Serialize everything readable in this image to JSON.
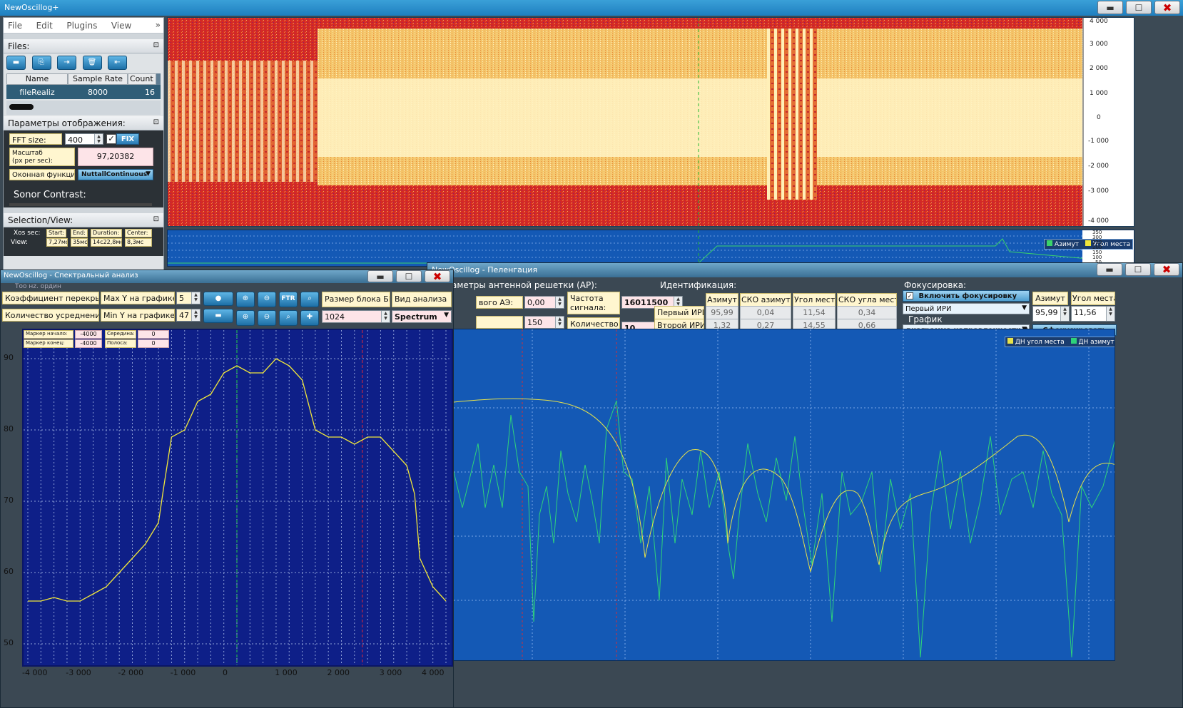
{
  "main": {
    "title": "NewOscillog+",
    "menu": [
      "File",
      "Edit",
      "Plugins",
      "View"
    ],
    "menu_more": "»"
  },
  "files": {
    "header": "Files:",
    "pin": "⊡",
    "columns": [
      "Name",
      "Sample Rate",
      "Count"
    ],
    "row": {
      "name": "fileRealiz",
      "rate": "8000",
      "count": "16"
    }
  },
  "display": {
    "header": "Параметры отображения:",
    "fft_label": "FFT size:",
    "fft_value": "400",
    "fix_label": "FIX",
    "scale_label": "Масштаб\n(px per sec):",
    "scale_value": "97,20382",
    "window_label": "Оконная функция:",
    "window_value": "NuttallContinuous",
    "sonor_label": "Sonor Contrast:"
  },
  "selection": {
    "header": "Selection/View:",
    "xos_label": "Xos sec:",
    "cols": [
      "Start:",
      "End:",
      "Duration:",
      "Center:"
    ],
    "view_label": "View:",
    "view_vals": [
      "7,27мс",
      "35мс",
      "14с22,8мс",
      "8,3мс"
    ]
  },
  "spectrogram": {
    "yticks": [
      "4 000",
      "3 000",
      "2 000",
      "1 000",
      "0",
      "-1 000",
      "-2 000",
      "-3 000",
      "-4 000"
    ],
    "legend": [
      "Азимут",
      "Угол места"
    ],
    "lower_ticks": [
      "350",
      "300",
      "250",
      "200",
      "150",
      "100",
      "50"
    ],
    "colors": {
      "low": "#d32822",
      "mid": "#f08d3c",
      "high": "#fff4c4"
    }
  },
  "spectral": {
    "title": "NewOscillog - Спектральный анализ",
    "overlap_label": "Коэффициент перекрытия",
    "maxy_label": "Max Y на графике:",
    "maxy_value": "5",
    "avg_label": "Количество усреднений:",
    "miny_label": "Min Y на графике:",
    "miny_value": "47",
    "ftr_label": "FTR",
    "block_label": "Размер блока БПФ",
    "block_value": "1024",
    "mode_label": "Вид анализа",
    "mode_value": "Spectrum",
    "marker_start_label": "Маркер начало:",
    "marker_start_value": "-4000",
    "marker_end_label": "Маркер конец:",
    "marker_end_value": "-4000",
    "middle_label": "Середина:",
    "middle_value": "0",
    "band_label": "Полоса:",
    "band_value": "0",
    "yticks": [
      "90",
      "80",
      "70",
      "60",
      "50"
    ],
    "xticks": [
      "-4 000",
      "-3 000",
      "-2 000",
      "-1 000",
      "0",
      "1 000",
      "2 000",
      "3 000",
      "4 000"
    ],
    "header_fragment": "Тоо нz. ордин",
    "chart_data": {
      "type": "line",
      "x": [
        -4000,
        -3750,
        -3500,
        -3250,
        -3000,
        -2750,
        -2500,
        -2250,
        -2000,
        -1750,
        -1500,
        -1400,
        -1250,
        -1000,
        -750,
        -500,
        -250,
        0,
        250,
        500,
        750,
        1000,
        1250,
        1500,
        1750,
        2000,
        2250,
        2500,
        2750,
        3000,
        3250,
        3400,
        3500,
        3750,
        4000
      ],
      "y": [
        56,
        56,
        56.5,
        56,
        56,
        57,
        58,
        60,
        62,
        64,
        67,
        72,
        79,
        80,
        84,
        85,
        88,
        89,
        88,
        88,
        90,
        89,
        87,
        80,
        79,
        79,
        78,
        79,
        79,
        77,
        75,
        71,
        62,
        58,
        56
      ],
      "xlim": [
        -4000,
        4000
      ],
      "ylim": [
        48,
        93
      ],
      "markers": [
        0,
        2400
      ]
    }
  },
  "bearing": {
    "title": "NewOscillog - Пеленгация",
    "ar_header": "Параметры антенной решетки (АР):",
    "first_ae_label": "вого АЭ:",
    "first_ae_value": "0,00",
    "second_value": "150",
    "freq_label": "Частота сигнала:",
    "freq_value": "16011500",
    "blocks_label": "Количество блоков:",
    "blocks_value": "10",
    "id_header": "Идентификация:",
    "id_cols": [
      "Азимут",
      "СКО азимута",
      "Угол места",
      "СКО угла места"
    ],
    "id_rows": [
      {
        "label": "Первый ИРИ",
        "vals": [
          "95,99",
          "0,04",
          "11,54",
          "0,34"
        ]
      },
      {
        "label": "Второй ИРИ",
        "vals": [
          "1,32",
          "0,27",
          "14,55",
          "0,66"
        ]
      }
    ],
    "focus_header": "Фокусировка:",
    "focus_enable": "Включить фокусировку",
    "focus_source": "Первый ИРИ",
    "graph_label": "График",
    "graph_value": "диаграмма направленности АР",
    "az_label": "Азимут",
    "az_value": "95,99",
    "elev_label": "Угол места",
    "elev_value": "11,56",
    "focus_button": "Сфокусировать",
    "legend": [
      "ДН угол места",
      "ДН азимут"
    ]
  }
}
